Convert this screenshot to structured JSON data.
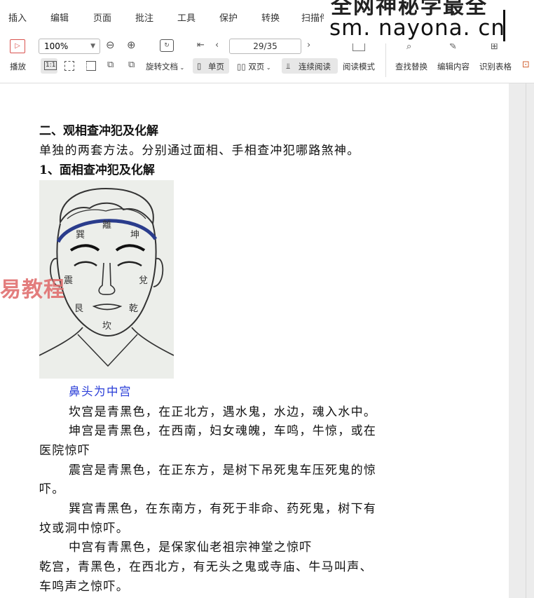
{
  "menu": {
    "items": [
      "插入",
      "编辑",
      "页面",
      "批注",
      "工具",
      "保护",
      "转换",
      "扫描件"
    ]
  },
  "toolbar": {
    "play_label": "播放",
    "zoom_value": "100%",
    "page_value": "29/35",
    "rotate_label": "旋转文档",
    "single_page_label": "单页",
    "double_page_label": "双页",
    "continuous_label": "连续阅读",
    "read_mode_label": "阅读模式",
    "find_replace_label": "查找替换",
    "edit_content_label": "编辑内容",
    "recognize_table_label": "识别表格",
    "fit_label": "1:1"
  },
  "watermark": {
    "top_text": "全网神秘学最全",
    "url": "sm. nayona. cn",
    "side_text": "易教程"
  },
  "document": {
    "heading2": "二、观相查冲犯及化解",
    "intro": "单独的两套方法。分别通过面相、手相查冲犯哪路煞神。",
    "heading3": "1、面相查冲犯及化解",
    "figure_labels": {
      "li": "離",
      "xun": "巽",
      "kun": "坤",
      "zhen": "震",
      "dui": "兌",
      "gen": "艮",
      "qian": "乾",
      "kan": "坎"
    },
    "caption": "鼻头为中宫",
    "lines": [
      "坎宫是青黑色，在正北方，遇水鬼，水边，魂入水中。",
      "坤宫是青黑色，在西南，妇女魂魄，车鸣，牛惊，或在",
      "医院惊吓",
      "震宫是青黑色，在正东方，是树下吊死鬼车压死鬼的惊",
      "吓。",
      "巽宫青黑色，在东南方，有死于非命、药死鬼，树下有",
      "坟或洞中惊吓。",
      "中宫有青黑色，是保家仙老祖宗神堂之惊吓",
      "乾宫，青黑色，在西北方，有无头之鬼或寺庙、牛马叫声、",
      "车鸣声之惊吓。"
    ]
  }
}
